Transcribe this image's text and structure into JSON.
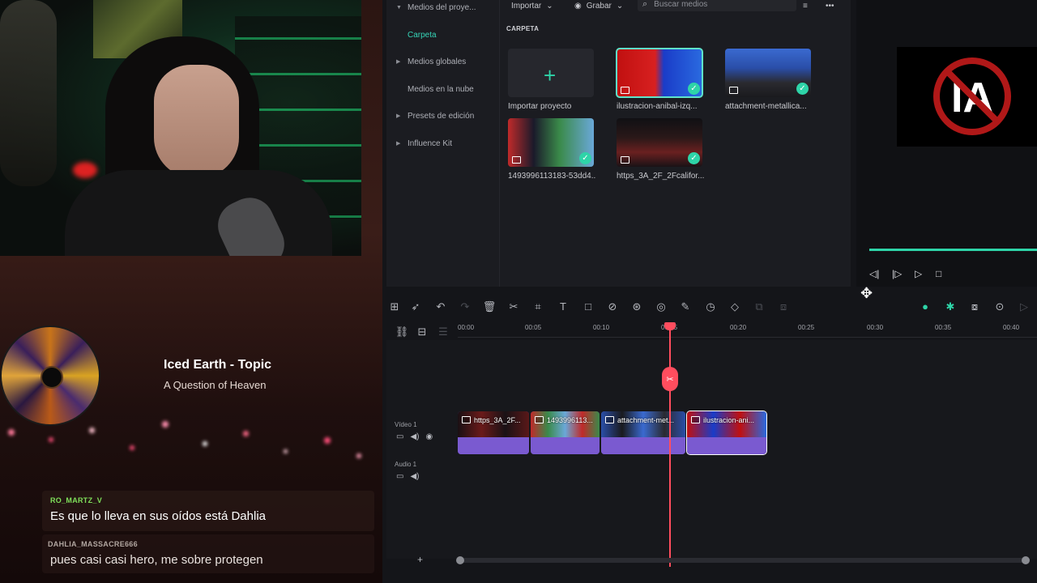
{
  "stream": {
    "song_title": "Iced Earth - Topic",
    "song_subtitle": "A Question of Heaven",
    "chat": [
      {
        "user": "RO_MARTZ_V",
        "text": "Es que lo lleva en sus oídos está Dahlia"
      },
      {
        "user": "DAHLIA_MASSACRE666",
        "text": "pues casi casi hero, me sobre protegen"
      }
    ],
    "user_colors": {
      "RO_MARTZ_V": "#7fe05a",
      "DAHLIA_MASSACRE666": "#b1a6a0"
    }
  },
  "editor": {
    "accent": "#2ed4a8",
    "playhead_color": "#ff4d5e",
    "sidebar": [
      {
        "label": "Medios del proye...",
        "arrow": "▼",
        "active": false
      },
      {
        "label": "Carpeta",
        "arrow": "",
        "active": true
      },
      {
        "label": "Medios globales",
        "arrow": "▶",
        "active": false
      },
      {
        "label": "Medios en la nube",
        "arrow": "",
        "active": false
      },
      {
        "label": "Presets de edición",
        "arrow": "▶",
        "active": false
      },
      {
        "label": "Influence Kit",
        "arrow": "▶",
        "active": false
      }
    ],
    "toolbar": {
      "import_label": "Importar",
      "record_label": "Grabar",
      "search_placeholder": "Buscar medios"
    },
    "folder_label": "CARPETA",
    "media": [
      {
        "name": "Importar proyecto",
        "type": "import"
      },
      {
        "name": "ilustracion-anibal-izq...",
        "type": "image",
        "selected": true
      },
      {
        "name": "attachment-metallica...",
        "type": "image",
        "selected": false
      },
      {
        "name": "1493996113183-53dd4...",
        "type": "image",
        "selected": false
      },
      {
        "name": "https_3A_2F_2Fcalifor...",
        "type": "image",
        "selected": false
      }
    ],
    "ruler_ticks": [
      "00:00",
      "00:05",
      "00:10",
      "00:15",
      "00:20",
      "00:25",
      "00:30",
      "00:35",
      "00:40"
    ],
    "tracks": {
      "video": "Vídeo 1",
      "audio": "Audio 1"
    },
    "clips": [
      {
        "name": "https_3A_2F..."
      },
      {
        "name": "1493996113..."
      },
      {
        "name": "attachment-met..."
      },
      {
        "name": "ilustracion-ani..."
      }
    ],
    "add_track_icon": "+",
    "preview_progress": 1.0
  }
}
